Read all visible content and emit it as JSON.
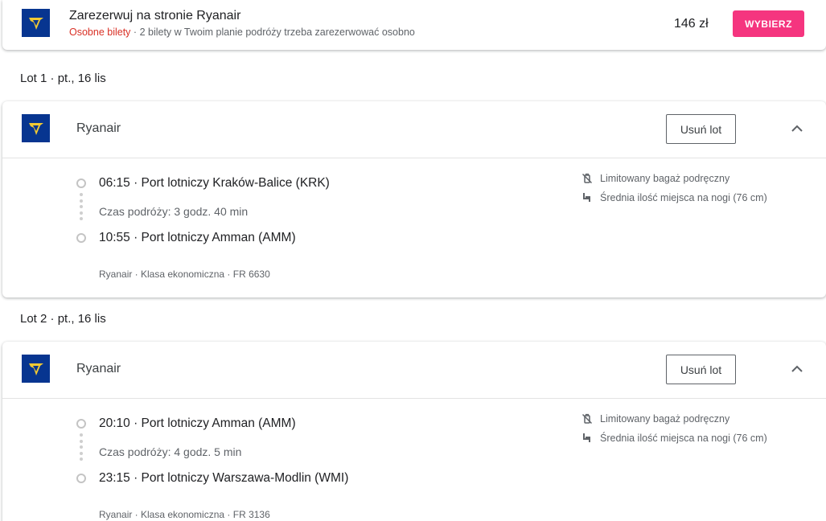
{
  "booking": {
    "title": "Zarezerwuj na stronie Ryanair",
    "separate_tag": "Osobne bilety",
    "note": "2 bilety w Twoim planie podróży trzeba zarezerwować osobno",
    "price": "146 zł",
    "choose_label": "WYBIERZ"
  },
  "colors": {
    "brand_navy": "#073590",
    "brand_yellow": "#f1c933",
    "choose_pink": "#f5357f",
    "separate_red": "#d93025"
  },
  "flights": [
    {
      "heading": "Lot 1 · pt., 16 lis",
      "airline": "Ryanair",
      "remove_label": "Usuń lot",
      "departure": "06:15 · Port lotniczy Kraków-Balice (KRK)",
      "duration": "Czas podróży: 3 godz. 40 min",
      "arrival": "10:55 · Port lotniczy Amman (AMM)",
      "meta": "Ryanair · Klasa ekonomiczna · FR 6630",
      "amenities": [
        "Limitowany bagaż podręczny",
        "Średnia ilość miejsca na nogi (76 cm)"
      ]
    },
    {
      "heading": "Lot 2 · pt., 16 lis",
      "airline": "Ryanair",
      "remove_label": "Usuń lot",
      "departure": "20:10 · Port lotniczy Amman (AMM)",
      "duration": "Czas podróży: 4 godz. 5 min",
      "arrival": "23:15 · Port lotniczy Warszawa-Modlin (WMI)",
      "meta": "Ryanair · Klasa ekonomiczna · FR 3136",
      "amenities": [
        "Limitowany bagaż podręczny",
        "Średnia ilość miejsca na nogi (76 cm)"
      ]
    }
  ],
  "icons": [
    "ryanair-logo",
    "no-bag-icon",
    "seat-icon",
    "chevron-up-icon"
  ]
}
